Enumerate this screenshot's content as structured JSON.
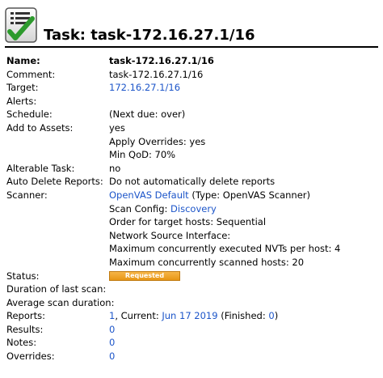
{
  "page": {
    "icon": "task-checklist-icon",
    "title": "Task: task-172.16.27.1/16"
  },
  "details": {
    "name": {
      "label": "Name:",
      "value": "task-172.16.27.1/16"
    },
    "comment": {
      "label": "Comment:",
      "value": "task-172.16.27.1/16"
    },
    "target": {
      "label": "Target:",
      "value": "172.16.27.1/16"
    },
    "alerts": {
      "label": "Alerts:",
      "value": ""
    },
    "schedule": {
      "label": "Schedule:",
      "value": "(Next due: over)"
    },
    "add_to_assets": {
      "label": "Add to Assets:",
      "value": "yes",
      "apply_overrides": "Apply Overrides: yes",
      "min_qod": "Min QoD: 70%"
    },
    "alterable_task": {
      "label": "Alterable Task:",
      "value": "no"
    },
    "auto_delete": {
      "label": "Auto Delete Reports:",
      "value": "Do not automatically delete reports"
    },
    "scanner": {
      "label": "Scanner:",
      "name": "OpenVAS Default",
      "type_text": " (Type: OpenVAS Scanner)",
      "scan_config_prefix": "Scan Config: ",
      "scan_config": "Discovery",
      "order": "Order for target hosts: Sequential",
      "network_source": "Network Source Interface:",
      "max_nvts": "Maximum concurrently executed NVTs per host: 4",
      "max_hosts": "Maximum concurrently scanned hosts: 20"
    },
    "status": {
      "label": "Status:",
      "value": "Requested",
      "color": "#f0a830"
    },
    "duration_last": {
      "label": "Duration of last scan:",
      "value": ""
    },
    "average_duration": {
      "label": "Average scan duration:",
      "value": ""
    },
    "reports": {
      "label": "Reports:",
      "count": "1",
      "current_prefix": ", Current: ",
      "current": "Jun 17 2019",
      "finished_prefix": " (Finished: ",
      "finished": "0",
      "finished_suffix": ")"
    },
    "results": {
      "label": "Results:",
      "value": "0"
    },
    "notes": {
      "label": "Notes:",
      "value": "0"
    },
    "overrides": {
      "label": "Overrides:",
      "value": "0"
    }
  },
  "colors": {
    "link": "#1c55c9",
    "check": "#2d9a2d"
  }
}
